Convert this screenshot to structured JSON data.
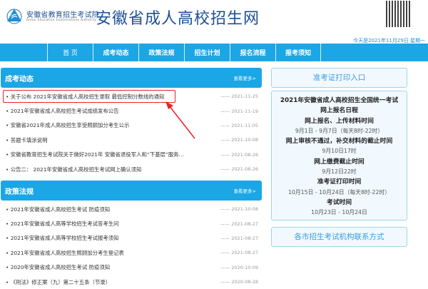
{
  "header": {
    "org_name": "安徽省教育招生考试院",
    "org_name_en": "Anhui Education Examinations Authority",
    "site_title": "安徽省成人高校招生网",
    "date": "今天是2021年11月29日 星期一"
  },
  "nav": [
    {
      "label": "首 页"
    },
    {
      "label": "成考动态"
    },
    {
      "label": "政策法规"
    },
    {
      "label": "招生计划"
    },
    {
      "label": "报名流程"
    },
    {
      "label": "报考须知"
    }
  ],
  "news": {
    "title": "成考动态",
    "more": "查看更多>",
    "items": [
      {
        "title": "关于公布 2021年安徽省成人高校招生录取 最低控制分数线的通知",
        "date": "—— 2021-11-25"
      },
      {
        "title": "2021年安徽省成人高校招生考试成绩发布公告",
        "date": "—— 2021-11-19"
      },
      {
        "title": "安徽省2021年成人高校招生享受照顾加分考生公示",
        "date": "—— 2021-11-05"
      },
      {
        "title": "答题卡填涂说明",
        "date": "—— 2021-10-08"
      },
      {
        "title": "安徽省教育招生考试院关于做好2021年 安徽省退役军人和“下基层”服务...",
        "date": "—— 2021-08-26"
      },
      {
        "title": "公告二： 2021年安徽省成人高校招生考试网上确认须知",
        "date": "—— 2021-08-26"
      }
    ]
  },
  "policy": {
    "title": "政策法规",
    "more": "查看更多>",
    "items": [
      {
        "title": "2021年安徽省成人高校招生考试 防疫须知",
        "date": "—— 2021-10-08"
      },
      {
        "title": "2021年安徽省成人高等学校招生考试答考生问",
        "date": "—— 2021-08-27"
      },
      {
        "title": "2021年安徽省成人高等学校招生考试报考须知",
        "date": "—— 2021-08-27"
      },
      {
        "title": "2021年安徽省成人高校招生照顾加分考生登记表",
        "date": "—— 2021-08-27"
      },
      {
        "title": "2020年安徽省成人高校招生考试 防疫须知",
        "date": "—— 2020-10-09"
      },
      {
        "title": "《刑法》修正案（九）第二十五条（节录）",
        "date": "—— 2020-08-28"
      }
    ]
  },
  "sidebar": {
    "print_entry": "准考证打印入口",
    "schedule": [
      {
        "text": "2021年安徽省成人高校招生全国统一考试",
        "bold": true
      },
      {
        "text": "网上报名日程",
        "bold": true
      },
      {
        "text": "网上报名、上传材料时间",
        "bold": true
      },
      {
        "text": "9月1日 - 9月7日（每天8时-22时）",
        "bold": false
      },
      {
        "text": "网上审核不通过，补交材料的截止时间",
        "bold": true
      },
      {
        "text": "9月10日17时",
        "bold": false
      },
      {
        "text": "网上缴费截止时间",
        "bold": true
      },
      {
        "text": "9月12日22时",
        "bold": false
      },
      {
        "text": "准考证打印时间",
        "bold": true
      },
      {
        "text": "10月15日 - 10月24日（每天8时-22时）",
        "bold": false
      },
      {
        "text": "考试时间",
        "bold": true
      },
      {
        "text": "10月23日 - 10月24日",
        "bold": false
      }
    ],
    "contact": "各市招生考试机构联系方式"
  },
  "colors": {
    "primary": "#1ba6e6",
    "highlight": "#e8231f"
  }
}
